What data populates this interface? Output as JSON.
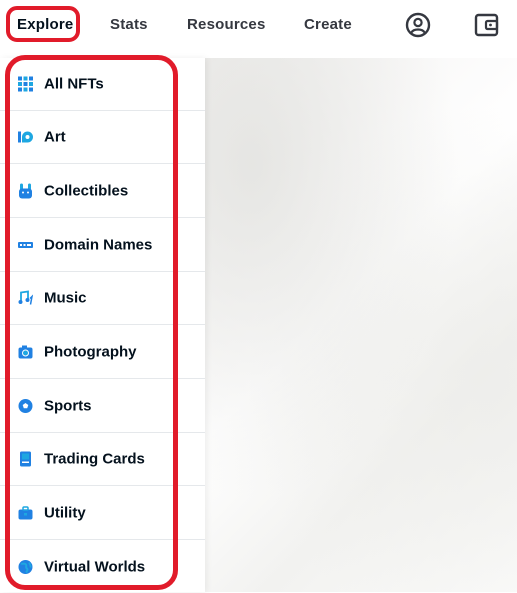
{
  "nav": {
    "explore": "Explore",
    "stats": "Stats",
    "resources": "Resources",
    "create": "Create"
  },
  "icons": {
    "account": "account-circle-icon",
    "wallet": "wallet-icon"
  },
  "colors": {
    "highlight": "#e11b2a",
    "icon_blue": "#2081e2",
    "icon_cyan": "#1ea7e1",
    "text": "#04111d"
  },
  "menu": {
    "items": [
      {
        "label": "All NFTs",
        "icon": "grid-icon"
      },
      {
        "label": "Art",
        "icon": "palette-icon"
      },
      {
        "label": "Collectibles",
        "icon": "bunny-icon"
      },
      {
        "label": "Domain Names",
        "icon": "domain-icon"
      },
      {
        "label": "Music",
        "icon": "music-note-icon"
      },
      {
        "label": "Photography",
        "icon": "camera-icon"
      },
      {
        "label": "Sports",
        "icon": "ball-icon"
      },
      {
        "label": "Trading Cards",
        "icon": "card-icon"
      },
      {
        "label": "Utility",
        "icon": "utility-icon"
      },
      {
        "label": "Virtual Worlds",
        "icon": "globe-icon"
      }
    ]
  }
}
